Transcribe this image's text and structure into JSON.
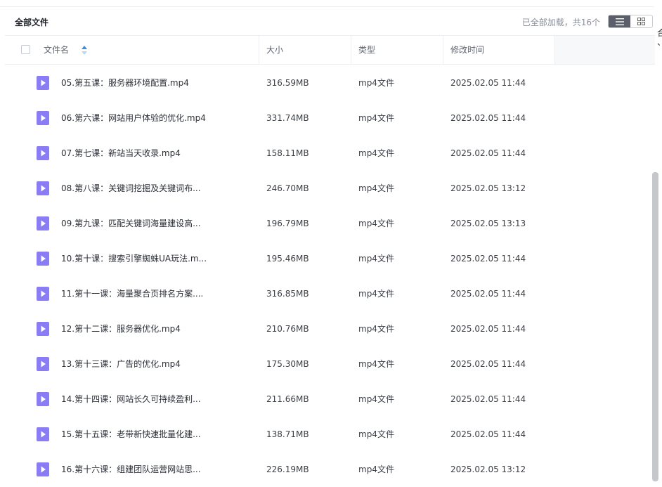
{
  "header": {
    "title": "全部文件",
    "loaded_status": "已全部加载，共16个"
  },
  "columns": {
    "name": "文件名",
    "size": "大小",
    "type": "类型",
    "modified": "修改时间"
  },
  "right_edge_glyphs": [
    "合",
    "、"
  ],
  "colors": {
    "file_icon": "#8a7cf5",
    "toggle_active": "#5a5f69",
    "sort_arrow": "#3a8ee6"
  },
  "files": [
    {
      "name": "05.第五课：服务器环境配置.mp4",
      "size": "316.59MB",
      "type": "mp4文件",
      "modified": "2025.02.05 11:44"
    },
    {
      "name": "06.第六课：网站用户体验的优化.mp4",
      "size": "331.74MB",
      "type": "mp4文件",
      "modified": "2025.02.05 11:44"
    },
    {
      "name": "07.第七课：新站当天收录.mp4",
      "size": "158.11MB",
      "type": "mp4文件",
      "modified": "2025.02.05 11:44"
    },
    {
      "name": "08.第八课：关键词挖掘及关键词布...",
      "size": "246.70MB",
      "type": "mp4文件",
      "modified": "2025.02.05 13:12"
    },
    {
      "name": "09.第九课：匹配关键词海量建设高...",
      "size": "196.79MB",
      "type": "mp4文件",
      "modified": "2025.02.05 13:13"
    },
    {
      "name": "10.第十课：搜索引擎蜘蛛UA玩法.m...",
      "size": "195.46MB",
      "type": "mp4文件",
      "modified": "2025.02.05 11:44"
    },
    {
      "name": "11.第十一课：海量聚合页排名方案....",
      "size": "316.85MB",
      "type": "mp4文件",
      "modified": "2025.02.05 11:44"
    },
    {
      "name": "12.第十二课：服务器优化.mp4",
      "size": "210.76MB",
      "type": "mp4文件",
      "modified": "2025.02.05 11:44"
    },
    {
      "name": "13.第十三课：广告的优化.mp4",
      "size": "175.30MB",
      "type": "mp4文件",
      "modified": "2025.02.05 11:44"
    },
    {
      "name": "14.第十四课：网站长久可持续盈利...",
      "size": "211.66MB",
      "type": "mp4文件",
      "modified": "2025.02.05 11:44"
    },
    {
      "name": "15.第十五课：老带新快速批量化建...",
      "size": "138.71MB",
      "type": "mp4文件",
      "modified": "2025.02.05 11:44"
    },
    {
      "name": "16.第十六课：组建团队运营网站思...",
      "size": "226.19MB",
      "type": "mp4文件",
      "modified": "2025.02.05 13:12"
    }
  ]
}
